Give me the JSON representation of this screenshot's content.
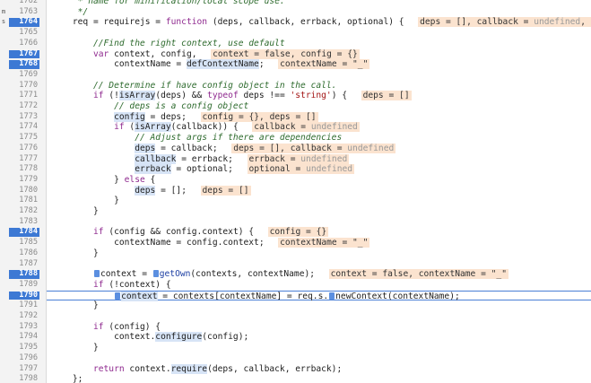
{
  "editor": {
    "left_markers": [
      {
        "text": "m",
        "line_index": 1
      },
      {
        "text": "s",
        "line_index": 2
      }
    ],
    "lines": [
      {
        "num": "1762",
        "bp": false,
        "tokens": [
          {
            "t": "com",
            "v": "      * name for minification/local scope use."
          }
        ]
      },
      {
        "num": "1763",
        "bp": false,
        "tokens": [
          {
            "t": "com",
            "v": "      */"
          }
        ]
      },
      {
        "num": "1764",
        "bp": true,
        "tokens": [
          {
            "t": "plain",
            "v": "     req = requirejs = "
          },
          {
            "t": "kw",
            "v": "function"
          },
          {
            "t": "plain",
            "v": " (deps, callback, errback, optional) {  "
          },
          {
            "t": "box",
            "v": "deps = [], callback = ",
            "dim": "undefined",
            ",rest": ", errback = und"
          }
        ]
      },
      {
        "num": "1765",
        "bp": false,
        "tokens": []
      },
      {
        "num": "1766",
        "bp": false,
        "tokens": [
          {
            "t": "com",
            "v": "         //Find the right context, use default"
          }
        ]
      },
      {
        "num": "1767",
        "bp": true,
        "tokens": [
          {
            "t": "plain",
            "v": "         "
          },
          {
            "t": "kw",
            "v": "var"
          },
          {
            "t": "plain",
            "v": " context, config,  "
          },
          {
            "t": "box",
            "v": "context = false, config = {}"
          }
        ]
      },
      {
        "num": "1768",
        "bp": true,
        "tokens": [
          {
            "t": "plain",
            "v": "             contextName = "
          },
          {
            "t": "hl",
            "v": "defContextName"
          },
          {
            "t": "plain",
            "v": ";  "
          },
          {
            "t": "box",
            "v": "contextName = \"_\""
          }
        ]
      },
      {
        "num": "1769",
        "bp": false,
        "tokens": []
      },
      {
        "num": "1770",
        "bp": false,
        "tokens": [
          {
            "t": "com",
            "v": "         // Determine if have config object in the call."
          }
        ]
      },
      {
        "num": "1771",
        "bp": false,
        "tokens": [
          {
            "t": "plain",
            "v": "         "
          },
          {
            "t": "kw",
            "v": "if"
          },
          {
            "t": "plain",
            "v": " (!"
          },
          {
            "t": "hl",
            "v": "isArray"
          },
          {
            "t": "plain",
            "v": "(deps) && "
          },
          {
            "t": "kw",
            "v": "typeof"
          },
          {
            "t": "plain",
            "v": " deps !== "
          },
          {
            "t": "str",
            "v": "'string'"
          },
          {
            "t": "plain",
            "v": ") {  "
          },
          {
            "t": "box",
            "v": "deps = []"
          }
        ]
      },
      {
        "num": "1772",
        "bp": false,
        "tokens": [
          {
            "t": "com",
            "v": "             // deps is a config object"
          }
        ]
      },
      {
        "num": "1773",
        "bp": false,
        "tokens": [
          {
            "t": "plain",
            "v": "             "
          },
          {
            "t": "hl",
            "v": "config"
          },
          {
            "t": "plain",
            "v": " = deps;  "
          },
          {
            "t": "box",
            "v": "config = {}, deps = []"
          }
        ]
      },
      {
        "num": "1774",
        "bp": false,
        "tokens": [
          {
            "t": "plain",
            "v": "             "
          },
          {
            "t": "kw",
            "v": "if"
          },
          {
            "t": "plain",
            "v": " ("
          },
          {
            "t": "hl",
            "v": "isArray"
          },
          {
            "t": "plain",
            "v": "(callback)) {  "
          },
          {
            "t": "box",
            "v": "callback = ",
            "dim": "undefined"
          }
        ]
      },
      {
        "num": "1775",
        "bp": false,
        "tokens": [
          {
            "t": "com",
            "v": "                 // Adjust args if there are dependencies"
          }
        ]
      },
      {
        "num": "1776",
        "bp": false,
        "tokens": [
          {
            "t": "plain",
            "v": "                 "
          },
          {
            "t": "hl",
            "v": "deps"
          },
          {
            "t": "plain",
            "v": " = callback;  "
          },
          {
            "t": "box",
            "v": "deps = [], callback = ",
            "dim": "undefined"
          }
        ]
      },
      {
        "num": "1777",
        "bp": false,
        "tokens": [
          {
            "t": "plain",
            "v": "                 "
          },
          {
            "t": "hl",
            "v": "callback"
          },
          {
            "t": "plain",
            "v": " = errback;  "
          },
          {
            "t": "box",
            "v": "errback = ",
            "dim": "undefined"
          }
        ]
      },
      {
        "num": "1778",
        "bp": false,
        "tokens": [
          {
            "t": "plain",
            "v": "                 "
          },
          {
            "t": "hl",
            "v": "errback"
          },
          {
            "t": "plain",
            "v": " = optional;  "
          },
          {
            "t": "box",
            "v": "optional = ",
            "dim": "undefined"
          }
        ]
      },
      {
        "num": "1779",
        "bp": false,
        "tokens": [
          {
            "t": "plain",
            "v": "             } "
          },
          {
            "t": "kw",
            "v": "else"
          },
          {
            "t": "plain",
            "v": " {"
          }
        ]
      },
      {
        "num": "1780",
        "bp": false,
        "tokens": [
          {
            "t": "plain",
            "v": "                 "
          },
          {
            "t": "hl",
            "v": "deps"
          },
          {
            "t": "plain",
            "v": " = [];  "
          },
          {
            "t": "box",
            "v": "deps = []"
          }
        ]
      },
      {
        "num": "1781",
        "bp": false,
        "tokens": [
          {
            "t": "plain",
            "v": "             }"
          }
        ]
      },
      {
        "num": "1782",
        "bp": false,
        "tokens": [
          {
            "t": "plain",
            "v": "         }"
          }
        ]
      },
      {
        "num": "1783",
        "bp": false,
        "tokens": []
      },
      {
        "num": "1784",
        "bp": true,
        "tokens": [
          {
            "t": "plain",
            "v": "         "
          },
          {
            "t": "kw",
            "v": "if"
          },
          {
            "t": "plain",
            "v": " (config && config.context) {  "
          },
          {
            "t": "box",
            "v": "config = {}"
          }
        ]
      },
      {
        "num": "1785",
        "bp": false,
        "tokens": [
          {
            "t": "plain",
            "v": "             contextName = config.context;  "
          },
          {
            "t": "box",
            "v": "contextName = \"_\""
          }
        ]
      },
      {
        "num": "1786",
        "bp": false,
        "tokens": [
          {
            "t": "plain",
            "v": "         }"
          }
        ]
      },
      {
        "num": "1787",
        "bp": false,
        "tokens": []
      },
      {
        "num": "1788",
        "bp": true,
        "tokens": [
          {
            "t": "plain",
            "v": "         "
          },
          {
            "t": "mark",
            "v": ""
          },
          {
            "t": "plain",
            "v": "context = "
          },
          {
            "t": "mark",
            "v": ""
          },
          {
            "t": "fn",
            "v": "getOwn"
          },
          {
            "t": "plain",
            "v": "(contexts, contextName);  "
          },
          {
            "t": "box",
            "v": "context = false, contextName = \"_\""
          }
        ]
      },
      {
        "num": "1789",
        "bp": false,
        "tokens": [
          {
            "t": "plain",
            "v": "         "
          },
          {
            "t": "kw",
            "v": "if"
          },
          {
            "t": "plain",
            "v": " (!context) {"
          }
        ]
      },
      {
        "num": "1790",
        "bp": true,
        "exec": true,
        "tokens": [
          {
            "t": "plain",
            "v": "             "
          },
          {
            "t": "mark",
            "v": ""
          },
          {
            "t": "hl",
            "v": "context"
          },
          {
            "t": "plain",
            "v": " = contexts[contextName] = req.s."
          },
          {
            "t": "mark",
            "v": ""
          },
          {
            "t": "plain",
            "v": "newContext(contextName);"
          }
        ]
      },
      {
        "num": "1791",
        "bp": false,
        "tokens": [
          {
            "t": "plain",
            "v": "         }"
          }
        ]
      },
      {
        "num": "1792",
        "bp": false,
        "tokens": []
      },
      {
        "num": "1793",
        "bp": false,
        "tokens": [
          {
            "t": "plain",
            "v": "         "
          },
          {
            "t": "kw",
            "v": "if"
          },
          {
            "t": "plain",
            "v": " (config) {"
          }
        ]
      },
      {
        "num": "1794",
        "bp": false,
        "tokens": [
          {
            "t": "plain",
            "v": "             context."
          },
          {
            "t": "hl",
            "v": "configure"
          },
          {
            "t": "plain",
            "v": "(config);"
          }
        ]
      },
      {
        "num": "1795",
        "bp": false,
        "tokens": [
          {
            "t": "plain",
            "v": "         }"
          }
        ]
      },
      {
        "num": "1796",
        "bp": false,
        "tokens": []
      },
      {
        "num": "1797",
        "bp": false,
        "tokens": [
          {
            "t": "plain",
            "v": "         "
          },
          {
            "t": "kw",
            "v": "return"
          },
          {
            "t": "plain",
            "v": " context."
          },
          {
            "t": "hl",
            "v": "require"
          },
          {
            "t": "plain",
            "v": "(deps, callback, errback);"
          }
        ]
      },
      {
        "num": "1798",
        "bp": false,
        "tokens": [
          {
            "t": "plain",
            "v": "     };"
          }
        ]
      }
    ]
  }
}
